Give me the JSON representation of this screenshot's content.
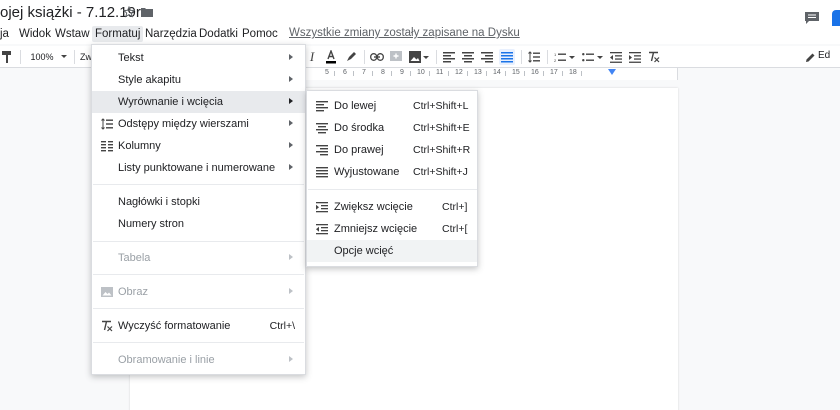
{
  "title_bar": {
    "doc_title": "ojej książki - 7.12.19r.",
    "star_icon": "star-outline-icon",
    "folder_icon": "folder-icon",
    "comments_icon": "comments-icon"
  },
  "menubar": {
    "items": [
      "ja",
      "Widok",
      "Wstaw",
      "Formatuj",
      "Narzędzia",
      "Dodatki",
      "Pomoc"
    ],
    "active": "Formatuj",
    "save_status": "Wszystkie zmiany zostały zapisane na Dysku"
  },
  "toolbar": {
    "zoom": "100%",
    "style_partial": "Zw",
    "edit_mode_partial": "Ed"
  },
  "ruler": {
    "numbers": [
      "5",
      "6",
      "7",
      "8",
      "9",
      "10",
      "11",
      "12",
      "13",
      "14",
      "15",
      "16",
      "17",
      "18"
    ]
  },
  "format_menu": {
    "items": [
      {
        "label": "Tekst",
        "icon": "",
        "has_submenu": true,
        "shortcut": "",
        "disabled": false
      },
      {
        "label": "Style akapitu",
        "icon": "",
        "has_submenu": true,
        "shortcut": "",
        "disabled": false
      },
      {
        "label": "Wyrównanie i wcięcia",
        "icon": "",
        "has_submenu": true,
        "shortcut": "",
        "disabled": false,
        "highlighted": true
      },
      {
        "label": "Odstępy między wierszami",
        "icon": "line-spacing-icon",
        "has_submenu": true,
        "shortcut": "",
        "disabled": false
      },
      {
        "label": "Kolumny",
        "icon": "columns-icon",
        "has_submenu": true,
        "shortcut": "",
        "disabled": false
      },
      {
        "label": "Listy punktowane i numerowane",
        "icon": "",
        "has_submenu": true,
        "shortcut": "",
        "disabled": false
      },
      {
        "label": "Nagłówki i stopki",
        "icon": "",
        "has_submenu": false,
        "shortcut": "",
        "disabled": false
      },
      {
        "label": "Numery stron",
        "icon": "",
        "has_submenu": false,
        "shortcut": "",
        "disabled": false
      },
      {
        "label": "Tabela",
        "icon": "",
        "has_submenu": true,
        "shortcut": "",
        "disabled": true
      },
      {
        "label": "Obraz",
        "icon": "image-icon",
        "has_submenu": true,
        "shortcut": "",
        "disabled": true
      },
      {
        "label": "Wyczyść formatowanie",
        "icon": "clear-formatting-icon",
        "has_submenu": false,
        "shortcut": "Ctrl+\\",
        "disabled": false
      },
      {
        "label": "Obramowanie i linie",
        "icon": "",
        "has_submenu": true,
        "shortcut": "",
        "disabled": true
      }
    ]
  },
  "align_menu": {
    "items": [
      {
        "label": "Do lewej",
        "shortcut": "Ctrl+Shift+L",
        "icon": "align-left-icon"
      },
      {
        "label": "Do środka",
        "shortcut": "Ctrl+Shift+E",
        "icon": "align-center-icon"
      },
      {
        "label": "Do prawej",
        "shortcut": "Ctrl+Shift+R",
        "icon": "align-right-icon"
      },
      {
        "label": "Wyjustowane",
        "shortcut": "Ctrl+Shift+J",
        "icon": "align-justify-icon"
      },
      {
        "label": "Zwiększ wcięcie",
        "shortcut": "Ctrl+]",
        "icon": "indent-increase-icon"
      },
      {
        "label": "Zmniejsz wcięcie",
        "shortcut": "Ctrl+[",
        "icon": "indent-decrease-icon"
      },
      {
        "label": "Opcje wcięć",
        "shortcut": "",
        "icon": "",
        "highlighted": true
      }
    ]
  }
}
